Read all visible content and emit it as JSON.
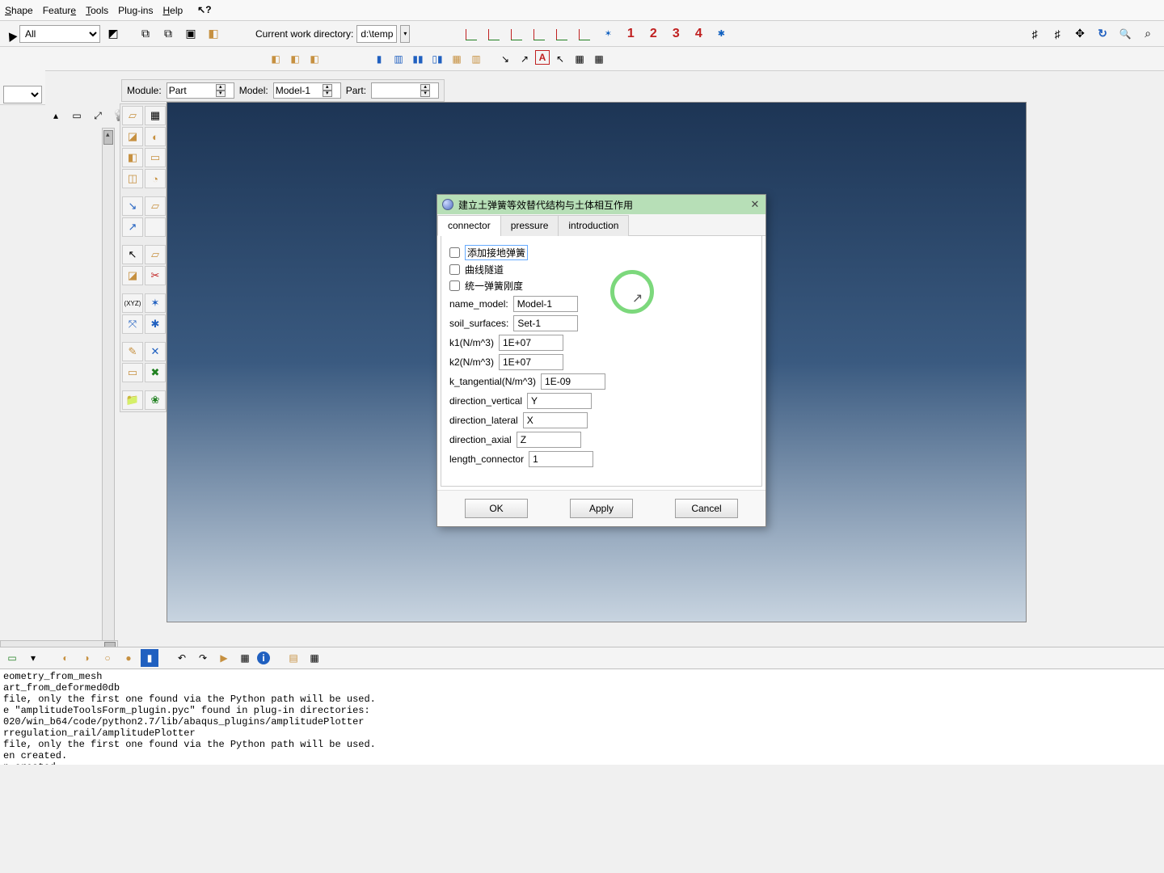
{
  "menu": {
    "shape": "Shape",
    "feature": "Feature",
    "tools": "Tools",
    "plugins": "Plug-ins",
    "help": "Help"
  },
  "top": {
    "selector_value": "All",
    "cwd_label": "Current work directory:",
    "cwd_value": "d:\\temp",
    "numbers": [
      "1",
      "2",
      "3",
      "4"
    ]
  },
  "context": {
    "module_label": "Module:",
    "module_value": "Part",
    "model_label": "Model:",
    "model_value": "Model-1",
    "part_label": "Part:",
    "part_value": ""
  },
  "dialog": {
    "title": "建立土弹簧等效替代结构与土体相互作用",
    "tabs": {
      "connector": "connector",
      "pressure": "pressure",
      "introduction": "introduction"
    },
    "chk1": "添加接地弹簧",
    "chk2": "曲线隧道",
    "chk3": "统一弹簧刚度",
    "fields": {
      "name_model_label": "name_model:",
      "name_model_value": "Model-1",
      "soil_surfaces_label": "soil_surfaces:",
      "soil_surfaces_value": "Set-1",
      "k1_label": "k1(N/m^3)",
      "k1_value": "1E+07",
      "k2_label": "k2(N/m^3)",
      "k2_value": "1E+07",
      "kt_label": "k_tangential(N/m^3)",
      "kt_value": "1E-09",
      "dv_label": "direction_vertical",
      "dv_value": "Y",
      "dl_label": "direction_lateral",
      "dl_value": "X",
      "da_label": "direction_axial",
      "da_value": "Z",
      "lc_label": "length_connector",
      "lc_value": "1"
    },
    "buttons": {
      "ok": "OK",
      "apply": "Apply",
      "cancel": "Cancel"
    }
  },
  "messages": "eometry_from_mesh\nart_from_deformed0db\nfile, only the first one found via the Python path will be used.\ne \"amplitudeToolsForm_plugin.pyc\" found in plug-in directories:\n020/win_b64/code/python2.7/lib/abaqus_plugins/amplitudePlotter\nrregulation_rail/amplitudePlotter\nfile, only the first one found via the Python path will be used.\nen created.\nn created."
}
